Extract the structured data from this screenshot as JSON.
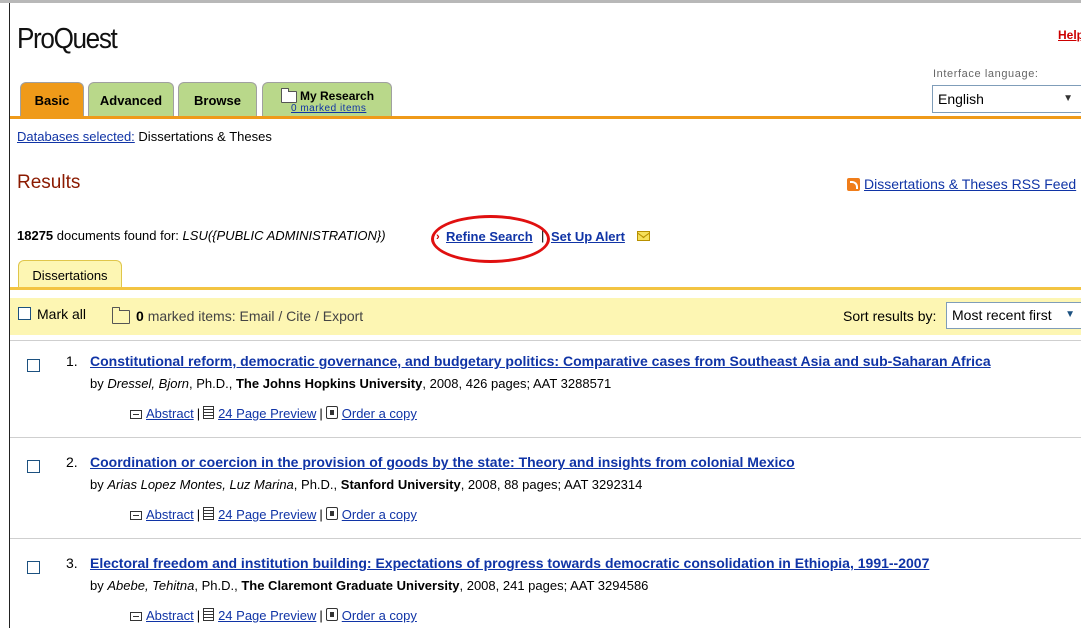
{
  "app": {
    "logo": "ProQuest",
    "help": "Help"
  },
  "language": {
    "label": "Interface language:",
    "value": "English"
  },
  "tabs": [
    {
      "label": "Basic"
    },
    {
      "label": "Advanced"
    },
    {
      "label": "Browse"
    },
    {
      "label": "My Research",
      "sublabel": "0 marked items"
    }
  ],
  "databases": {
    "label": "Databases selected:",
    "value": "Dissertations & Theses"
  },
  "results": {
    "title": "Results",
    "rss": "Dissertations & Theses RSS Feed"
  },
  "search": {
    "count": "18275",
    "found_text": "documents found for:",
    "query": "LSU({PUBLIC ADMINISTRATION})",
    "refine": "Refine Search",
    "separator": "|",
    "alert": "Set Up Alert"
  },
  "subtab": "Dissertations",
  "toolbar": {
    "mark_all": "Mark all",
    "marked_count": "0",
    "marked_text": "marked items: Email / Cite / Export",
    "sort_label": "Sort results by:",
    "sort_value": "Most recent first"
  },
  "links": {
    "abstract": "Abstract",
    "preview": "24 Page Preview",
    "order": "Order a copy"
  },
  "items": [
    {
      "num": "1.",
      "title": "Constitutional reform, democratic governance, and budgetary politics: Comparative cases from Southeast Asia and sub-Saharan Africa",
      "by": "by",
      "author": "Dressel, Bjorn",
      "degree": ", Ph.D.,",
      "university": "The Johns Hopkins University",
      "details": ", 2008, 426 pages; AAT 3288571"
    },
    {
      "num": "2.",
      "title": "Coordination or coercion in the provision of goods by the state: Theory and insights from colonial Mexico",
      "by": "by",
      "author": "Arias Lopez Montes, Luz Marina",
      "degree": ", Ph.D.,",
      "university": "Stanford University",
      "details": ", 2008, 88 pages; AAT 3292314"
    },
    {
      "num": "3.",
      "title": "Electoral freedom and institution building: Expectations of progress towards democratic consolidation in Ethiopia, 1991--2007",
      "by": "by",
      "author": "Abebe, Tehitna",
      "degree": ", Ph.D.,",
      "university": "The Claremont Graduate University",
      "details": ", 2008, 241 pages; AAT 3294586"
    }
  ],
  "colors": {
    "active_tab": "#ef9a19",
    "inactive_tab": "#b9d88a",
    "toolbar_bg": "#fdf6b3",
    "link": "#1034a6",
    "title_red": "#8b1a00",
    "highlight_circle": "#e01010"
  }
}
